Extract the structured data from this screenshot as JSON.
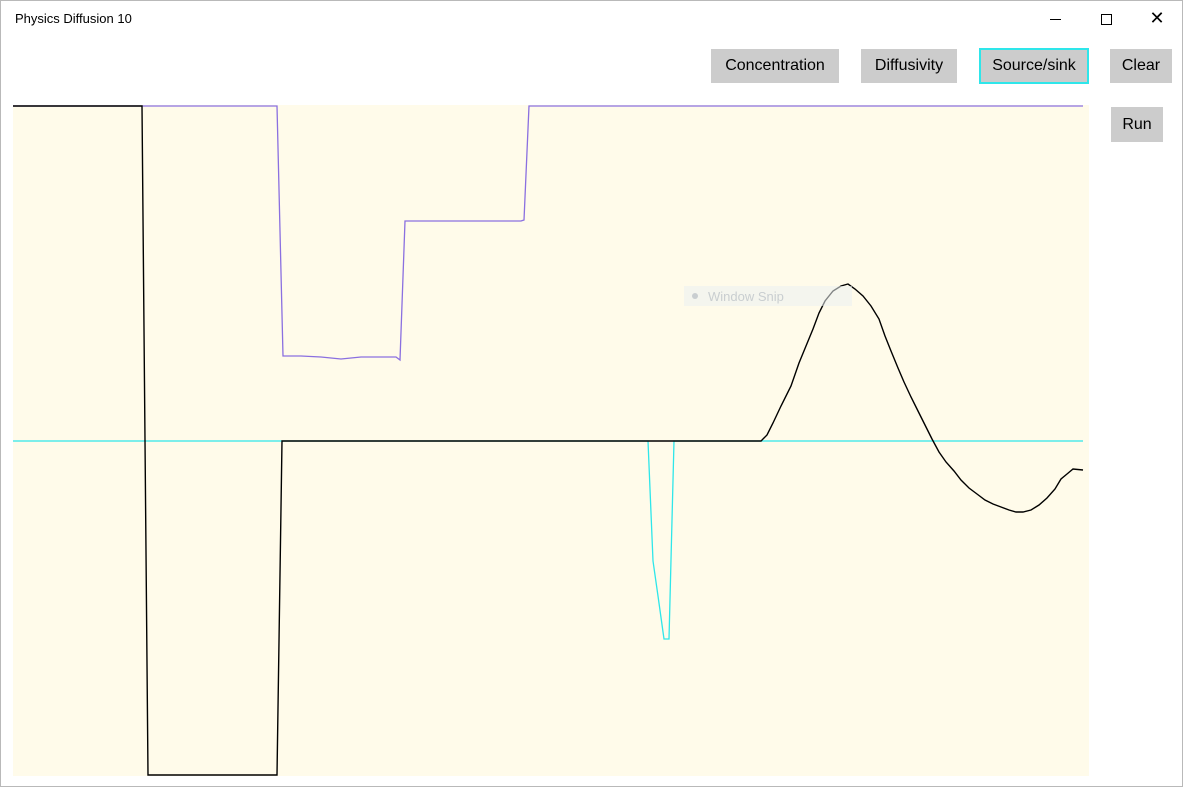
{
  "window": {
    "title": "Physics Diffusion 10"
  },
  "toolbar": {
    "concentration_label": "Concentration",
    "diffusivity_label": "Diffusivity",
    "source_sink_label": "Source/sink",
    "clear_label": "Clear",
    "run_label": "Run",
    "selected": "Source/sink"
  },
  "overlay_tooltip": {
    "label": "Window Snip"
  },
  "colors": {
    "plot_background": "#fffbea",
    "concentration_line": "#000000",
    "diffusivity_line": "#8a6fe0",
    "source_sink_line": "#2ee6ea",
    "button": "#cccccc",
    "selected_border": "#2ee6ea"
  },
  "icons": {
    "minimize": "minimize-icon",
    "maximize": "maximize-icon",
    "close": "close-icon"
  }
}
